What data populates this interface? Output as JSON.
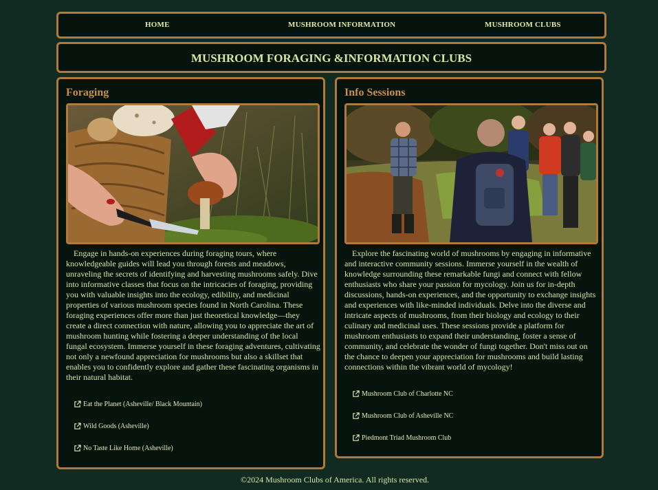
{
  "nav": {
    "home": "HOME",
    "info": "MUSHROOM INFORMATION",
    "clubs": "MUSHROOM CLUBS"
  },
  "banner": {
    "title": "MUSHROOM FORAGING &INFORMATION CLUBS"
  },
  "foraging": {
    "heading": "Foraging",
    "image_alt": "Hands cutting a mushroom with a knife beside a wicker basket",
    "text": "Engage in hands-on experiences during foraging tours, where knowledgeable guides will lead you through forests and meadows, unraveling the secrets of identifying and harvesting mushrooms safely. Dive into informative classes that focus on the intricacies of foraging, providing you with valuable insights into the ecology, edibility, and medicinal properties of various mushroom species found in North Carolina. These foraging experiences offer more than just theoretical knowledge—they create a direct connection with nature, allowing you to appreciate the art of mushroom hunting while fostering a deeper understanding of the local fungal ecosystem. Immerse yourself in these foraging adventures, cultivating not only a newfound appreciation for mushrooms but also a skillset that enables you to confidently explore and gather these fascinating organisms in their natural habitat.",
    "links": [
      "Eat the Planet (Asheville/ Black Mountain)",
      "Wild Goods (Asheville)",
      "No Taste Like Home (Asheville)"
    ]
  },
  "sessions": {
    "heading": "Info Sessions",
    "image_alt": "A guide talking to a group of people in a forest clearing",
    "text": "Explore the fascinating world of mushrooms by engaging in informative and interactive community sessions. Immerse yourself in the wealth of knowledge surrounding these remarkable fungi and connect with fellow enthusiasts who share your passion for mycology. Join us for in-depth discussions, hands-on experiences, and the opportunity to exchange insights and experiences with like-minded individuals. Delve into the diverse and intricate aspects of mushrooms, from their biology and ecology to their culinary and medicinal uses. These sessions provide a platform for mushroom enthusiasts to expand their understanding, foster a sense of community, and celebrate the wonder of fungi together. Don't miss out on the chance to deepen your appreciation for mushrooms and build lasting connections within the vibrant world of mycology!",
    "links": [
      "Mushroom Club of Charlotte NC",
      "Mushroom Club of Asheville NC",
      "Piedmont Triad Mushroom Club"
    ]
  },
  "footer": {
    "text": "©2024 Mushroom Clubs of America. All rights reserved."
  },
  "colors": {
    "background": "#112a22",
    "panel": "#06140d",
    "border": "#b07a3a",
    "heading": "#c98f4f",
    "text": "#d6e9a8"
  }
}
